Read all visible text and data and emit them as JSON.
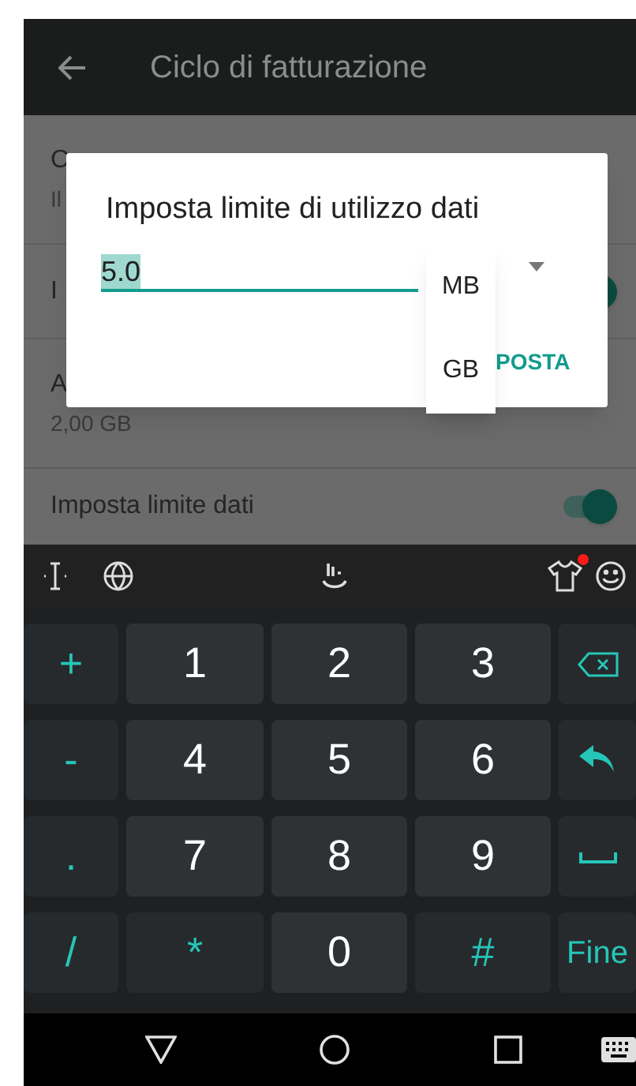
{
  "app_bar": {
    "title": "Ciclo di fatturazione"
  },
  "settings": [
    {
      "kind": "text",
      "title": "C",
      "subtitle": "Il"
    },
    {
      "kind": "toggle",
      "title": "I",
      "on": true
    },
    {
      "kind": "text",
      "title": "A",
      "subtitle": "2,00 GB"
    },
    {
      "kind": "toggle",
      "title": "Imposta limite dati",
      "on": true
    }
  ],
  "dialog": {
    "title": "Imposta limite di utilizzo dati",
    "value": "5.0",
    "button": "POSTA"
  },
  "unit_menu": [
    {
      "label": "MB"
    },
    {
      "label": "GB"
    }
  ],
  "keyboard": {
    "rows": [
      [
        {
          "kind": "symbol",
          "label": "+"
        },
        {
          "kind": "digit",
          "label": "1"
        },
        {
          "kind": "digit",
          "label": "2"
        },
        {
          "kind": "digit",
          "label": "3"
        },
        {
          "kind": "backspace"
        }
      ],
      [
        {
          "kind": "symbol",
          "label": "-"
        },
        {
          "kind": "digit",
          "label": "4"
        },
        {
          "kind": "digit",
          "label": "5"
        },
        {
          "kind": "digit",
          "label": "6"
        },
        {
          "kind": "enter"
        }
      ],
      [
        {
          "kind": "symbol",
          "label": "."
        },
        {
          "kind": "digit",
          "label": "7"
        },
        {
          "kind": "digit",
          "label": "8"
        },
        {
          "kind": "digit",
          "label": "9"
        },
        {
          "kind": "space"
        }
      ],
      [
        {
          "kind": "symbol",
          "label": "/"
        },
        {
          "kind": "symbol",
          "label": "*"
        },
        {
          "kind": "digit",
          "label": "0"
        },
        {
          "kind": "symbol",
          "label": "#"
        },
        {
          "kind": "action",
          "label": "Fine"
        }
      ]
    ]
  }
}
